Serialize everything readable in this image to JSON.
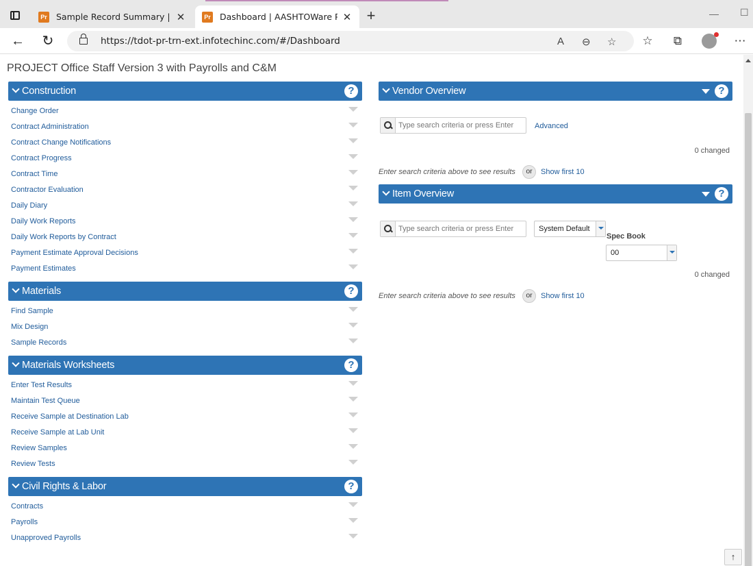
{
  "browser": {
    "tabs": [
      {
        "favicon": "Pr",
        "title": "Sample Record Summary | AASHTOWare Project"
      },
      {
        "favicon": "Pr",
        "title": "Dashboard | AASHTOWare Project"
      }
    ],
    "url": "https://tdot-pr-trn-ext.infotechinc.com/#/Dashboard"
  },
  "page": {
    "title": "PROJECT Office Staff Version 3 with Payrolls and C&M"
  },
  "left_panels": [
    {
      "title": "Construction",
      "items": [
        "Change Order",
        "Contract Administration",
        "Contract Change Notifications",
        "Contract Progress",
        "Contract Time",
        "Contractor Evaluation",
        "Daily Diary",
        "Daily Work Reports",
        "Daily Work Reports by Contract",
        "Payment Estimate Approval Decisions",
        "Payment Estimates"
      ]
    },
    {
      "title": "Materials",
      "items": [
        "Find Sample",
        "Mix Design",
        "Sample Records"
      ]
    },
    {
      "title": "Materials Worksheets",
      "items": [
        "Enter Test Results",
        "Maintain Test Queue",
        "Receive Sample at Destination Lab",
        "Receive Sample at Lab Unit",
        "Review Samples",
        "Review Tests"
      ]
    },
    {
      "title": "Civil Rights & Labor",
      "items": [
        "Contracts",
        "Payrolls",
        "Unapproved Payrolls"
      ]
    }
  ],
  "vendor_overview": {
    "title": "Vendor Overview",
    "search_placeholder": "Type search criteria or press Enter",
    "advanced": "Advanced",
    "changed": "0 changed",
    "hint": "Enter search criteria above to see results",
    "or": "or",
    "show_first": "Show first 10"
  },
  "item_overview": {
    "title": "Item Overview",
    "search_placeholder": "Type search criteria or press Enter",
    "system_default": "System Default",
    "spec_book_label": "Spec Book",
    "spec_book_value": "00",
    "changed": "0 changed",
    "hint": "Enter search criteria above to see results",
    "or": "or",
    "show_first": "Show first 10"
  },
  "icons": {
    "help": "?",
    "close": "✕",
    "new_tab": "+"
  }
}
